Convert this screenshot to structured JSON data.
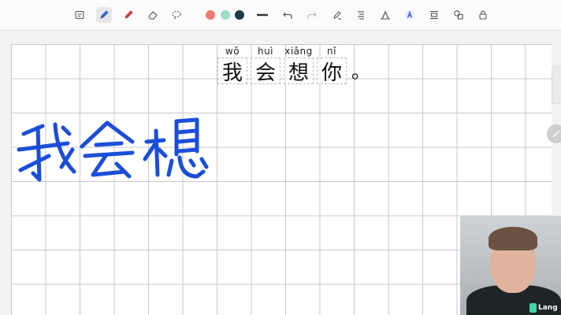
{
  "toolbar": {
    "tools": [
      {
        "name": "text-box-icon"
      },
      {
        "name": "pen-icon",
        "active": true
      },
      {
        "name": "marker-icon"
      },
      {
        "name": "eraser-icon"
      },
      {
        "name": "lasso-icon"
      }
    ],
    "colors": [
      "#f07b73",
      "#9fdcc8",
      "#1f3b4a"
    ],
    "actions": [
      "stroke-width-icon",
      "undo-icon",
      "redo-icon",
      "pen-settings-icon",
      "text-format-icon",
      "text-size-icon",
      "ai-icon",
      "align-icon",
      "shapes-icon",
      "lock-icon"
    ]
  },
  "sentence": {
    "syllables": [
      {
        "pinyin": "wǒ",
        "hanzi": "我"
      },
      {
        "pinyin": "huì",
        "hanzi": "会"
      },
      {
        "pinyin": "xiǎng",
        "hanzi": "想"
      },
      {
        "pinyin": "nǐ",
        "hanzi": "你"
      }
    ],
    "punctuation": "。"
  },
  "handwriting": {
    "text": "我会想",
    "color": "#1b4ed8"
  },
  "video": {
    "brand": "Lang"
  }
}
